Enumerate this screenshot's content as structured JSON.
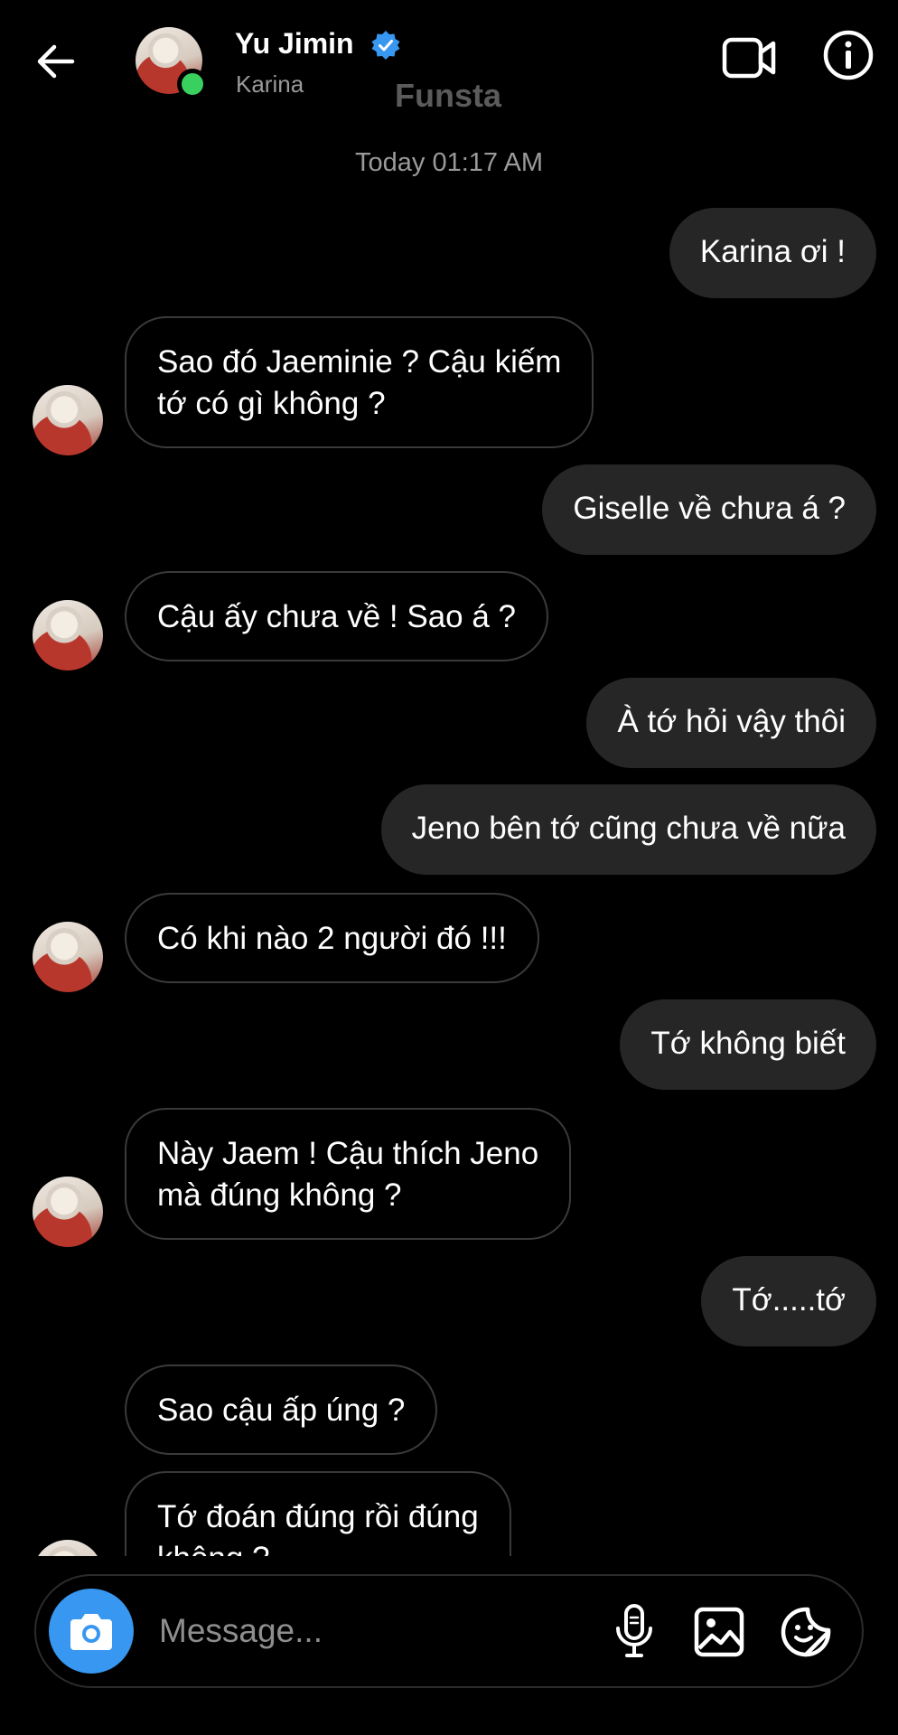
{
  "header": {
    "name": "Yu Jimin",
    "subtitle": "Karina",
    "overlay_text": "Funsta",
    "online": true,
    "verified_color": "#3897f0",
    "icons": [
      "back-arrow-icon",
      "verified-badge-icon",
      "video-call-icon",
      "info-icon"
    ]
  },
  "thread": {
    "timestamp": "Today 01:17 AM",
    "messages": [
      {
        "from": "me",
        "text": "Karina ơi !"
      },
      {
        "from": "them",
        "text": "Sao đó Jaeminie ? Cậu kiếm\ntớ có gì không ?"
      },
      {
        "from": "me",
        "text": "Giselle về chưa á ?"
      },
      {
        "from": "them",
        "text": "Cậu ấy chưa về ! Sao á ?"
      },
      {
        "from": "me",
        "text": "À tớ hỏi vậy thôi"
      },
      {
        "from": "me",
        "text": "Jeno bên tớ cũng chưa về nữa"
      },
      {
        "from": "them",
        "text": "Có khi nào 2 người đó !!!"
      },
      {
        "from": "me",
        "text": "Tớ không biết"
      },
      {
        "from": "them",
        "text": "Này Jaem ! Cậu thích Jeno\nmà đúng không ?"
      },
      {
        "from": "me",
        "text": "Tớ.....tớ"
      },
      {
        "from": "them",
        "text": "Sao cậu ấp úng ?"
      },
      {
        "from": "them",
        "text": "Tớ đoán đúng rồi đúng\nkhông ?"
      }
    ]
  },
  "composer": {
    "placeholder": "Message...",
    "camera_color": "#3897f0",
    "icons": [
      "camera-icon",
      "microphone-icon",
      "gallery-icon",
      "sticker-icon"
    ]
  },
  "colors": {
    "background": "#000000",
    "outgoing_bubble": "#262626",
    "incoming_border": "#3a3a3a",
    "secondary_text": "#9a9a9a"
  }
}
